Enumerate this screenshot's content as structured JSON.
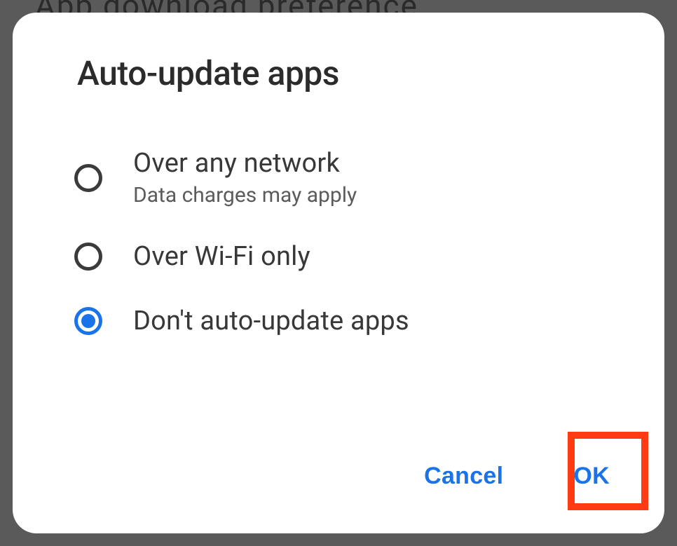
{
  "background_text": "App download preference",
  "dialog": {
    "title": "Auto-update apps",
    "options": [
      {
        "label": "Over any network",
        "sub": "Data charges may apply",
        "selected": false
      },
      {
        "label": "Over Wi-Fi only",
        "sub": "",
        "selected": false
      },
      {
        "label": "Don't auto-update apps",
        "sub": "",
        "selected": true
      }
    ],
    "cancel_label": "Cancel",
    "ok_label": "OK"
  },
  "colors": {
    "accent": "#1a73e8",
    "highlight_border": "#ff3b14"
  }
}
